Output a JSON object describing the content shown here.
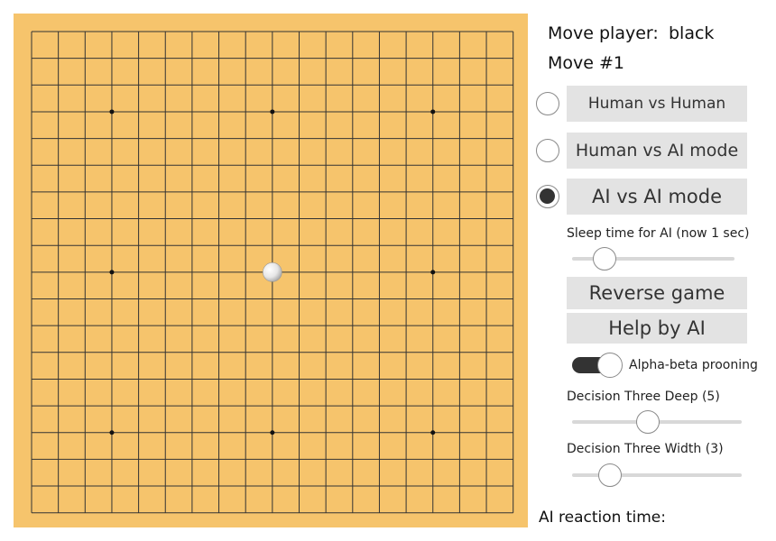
{
  "status": {
    "player_label": "Move player:",
    "player_value": "black",
    "move_label": "Move #1"
  },
  "modes": [
    {
      "label": "Human vs Human",
      "selected": false
    },
    {
      "label": "Human vs AI mode",
      "selected": false
    },
    {
      "label": "AI vs AI mode",
      "selected": true
    }
  ],
  "sleep": {
    "label": "Sleep time for AI (now 1 sec)",
    "value": 1,
    "min": 0,
    "max": 5
  },
  "buttons": {
    "reverse": "Reverse game",
    "help": "Help by AI"
  },
  "alpha_beta": {
    "label": "Alpha-beta prooning",
    "on": true
  },
  "depth": {
    "label": "Decision Three Deep (5)",
    "value": 5,
    "min": 1,
    "max": 10
  },
  "width": {
    "label": "Decision Three Width (3)",
    "value": 3,
    "min": 1,
    "max": 10
  },
  "reaction": {
    "label": "AI reaction time:"
  },
  "board": {
    "size": 19,
    "background": "#f6c46c",
    "line_color": "#333333",
    "star_points": [
      [
        3,
        3
      ],
      [
        3,
        9
      ],
      [
        3,
        15
      ],
      [
        9,
        3
      ],
      [
        9,
        15
      ],
      [
        15,
        3
      ],
      [
        15,
        9
      ],
      [
        15,
        15
      ]
    ],
    "stones": [
      {
        "col": 9,
        "row": 9,
        "color": "white"
      }
    ]
  }
}
